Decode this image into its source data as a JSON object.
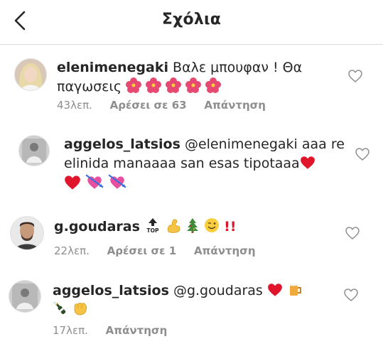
{
  "header": {
    "title": "Σχόλια"
  },
  "comments": [
    {
      "username": "elenimenegaki",
      "text": "Βαλε μπουφαν ! Θα",
      "text2": "παγωσεις",
      "time": "43λεπ.",
      "likes": "Αρέσει σε 63",
      "reply": "Απάντηση",
      "emoji": [
        "hibiscus",
        "hibiscus",
        "hibiscus",
        "hibiscus",
        "hibiscus"
      ]
    },
    {
      "username": "aggelos_latsios",
      "mention": "@elenimenegaki",
      "text": "aaa re",
      "text2": "elinida manaaaa san esas tipotaaa",
      "emoji": [
        "red-heart",
        "heart-with-arrow",
        "heart-with-arrow"
      ]
    },
    {
      "username": "g.goudaras",
      "time": "22λεπ.",
      "likes": "Αρέσει σε 1",
      "reply": "Απάντηση",
      "emoji": [
        "top-arrow",
        "flexed-biceps",
        "christmas-tree",
        "winking-face"
      ],
      "bangs": "!!"
    },
    {
      "username": "aggelos_latsios",
      "mention": "@g.goudaras",
      "time": "17λεπ.",
      "reply": "Απάντηση",
      "emoji": [
        "red-heart",
        "beer-mug",
        "champagne-bottle",
        "oncoming-fist"
      ]
    }
  ],
  "colors": {
    "text": "#262626",
    "meta": "#8e8e8e",
    "border": "#dbdbdb",
    "heart_red": "#e0152c"
  }
}
